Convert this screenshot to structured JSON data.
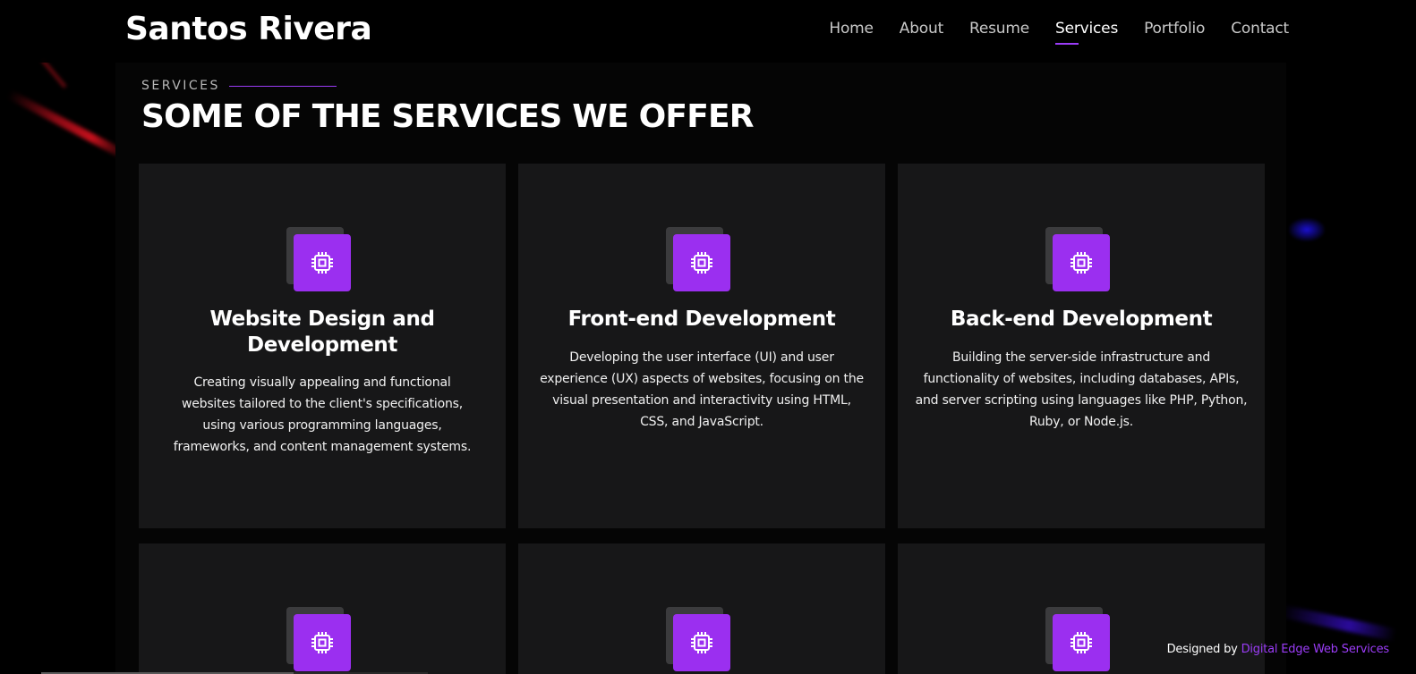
{
  "header": {
    "logo": "Santos Rivera",
    "nav": [
      {
        "label": "Home",
        "active": false
      },
      {
        "label": "About",
        "active": false
      },
      {
        "label": "Resume",
        "active": false
      },
      {
        "label": "Services",
        "active": true
      },
      {
        "label": "Portfolio",
        "active": false
      },
      {
        "label": "Contact",
        "active": false
      }
    ]
  },
  "section": {
    "label": "SERVICES",
    "title": "SOME OF THE SERVICES WE OFFER"
  },
  "services": [
    {
      "icon": "cpu-chip-icon",
      "title": "Website Design and Development",
      "description": "Creating visually appealing and functional websites tailored to the client's specifications, using various programming languages, frameworks, and content management systems."
    },
    {
      "icon": "cpu-chip-icon",
      "title": "Front-end Development",
      "description": "Developing the user interface (UI) and user experience (UX) aspects of websites, focusing on the visual presentation and interactivity using HTML, CSS, and JavaScript."
    },
    {
      "icon": "cpu-chip-icon",
      "title": "Back-end Development",
      "description": "Building the server-side infrastructure and functionality of websites, including databases, APIs, and server scripting using languages like PHP, Python, Ruby, or Node.js."
    },
    {
      "icon": "cpu-chip-icon"
    },
    {
      "icon": "cpu-chip-icon"
    },
    {
      "icon": "cpu-chip-icon"
    }
  ],
  "footer": {
    "credit_prefix": "Designed by",
    "credit_link": "Digital Edge Web Services"
  },
  "colors": {
    "accent": "#9b2ff0",
    "background": "#000000",
    "card": "#171718"
  }
}
